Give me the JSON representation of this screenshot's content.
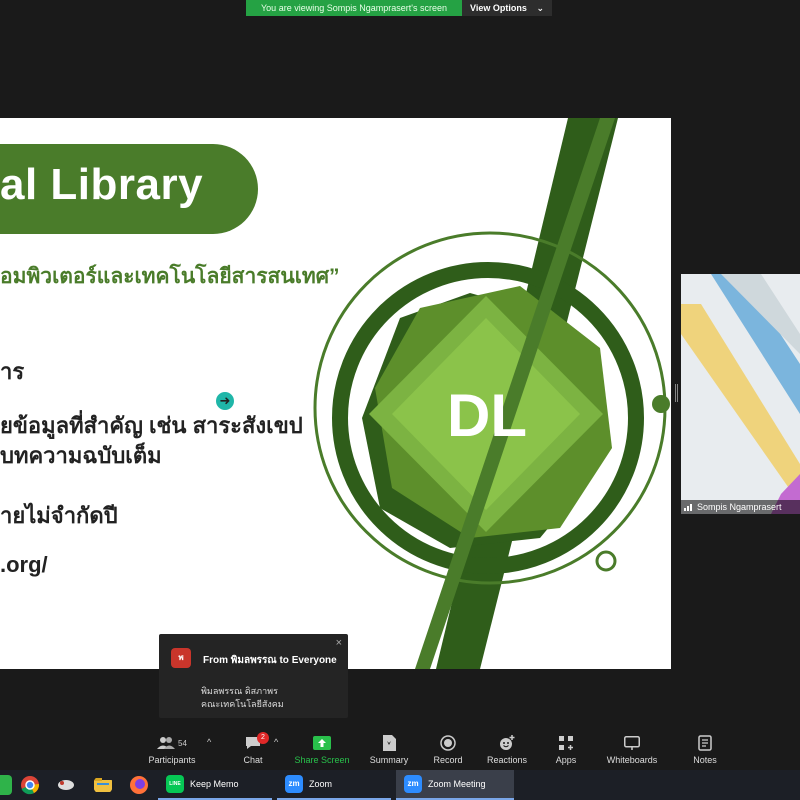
{
  "banner": {
    "message": "You are viewing Sompis Ngamprasert's screen",
    "options_label": "View Options",
    "options_caret": "⌄"
  },
  "slide": {
    "title": "al Library",
    "subtitle": "อมพิวเตอร์และเทคโนโลยีสารสนเทศ”",
    "bullets": [
      "าร",
      "ยข้อมูลที่สำคัญ เช่น สาระสังเขป",
      "บทความฉบับเต็ม",
      "ายไม่จำกัดปี",
      ".org/"
    ],
    "logo_text": "DL",
    "colors": {
      "green": "#4a7c2a",
      "dark_green": "#2f5d1a",
      "light_green": "#8bc34a"
    }
  },
  "pointer": {
    "glyph": "➜"
  },
  "video": {
    "name": "Sompis Ngamprasert"
  },
  "chat_toast": {
    "avatar": "พ",
    "from": "From พิมลพรรณ to Everyone",
    "line1": "พิมลพรรณ ดิสภาพร",
    "line2": "คณะเทคโนโลยีสังคม",
    "close": "×"
  },
  "toolbar": {
    "participants": {
      "label": "Participants",
      "count": "54"
    },
    "chat": {
      "label": "Chat",
      "badge": "2"
    },
    "share": {
      "label": "Share Screen"
    },
    "summary": {
      "label": "Summary"
    },
    "record": {
      "label": "Record"
    },
    "reactions": {
      "label": "Reactions"
    },
    "apps": {
      "label": "Apps"
    },
    "whiteboards": {
      "label": "Whiteboards"
    },
    "notes": {
      "label": "Notes"
    },
    "caret": "^"
  },
  "taskbar": {
    "apps": [
      {
        "label": "Keep Memo",
        "icon": "LINE"
      },
      {
        "label": "Zoom",
        "icon": "zm"
      },
      {
        "label": "Zoom Meeting",
        "icon": "zm"
      }
    ]
  }
}
